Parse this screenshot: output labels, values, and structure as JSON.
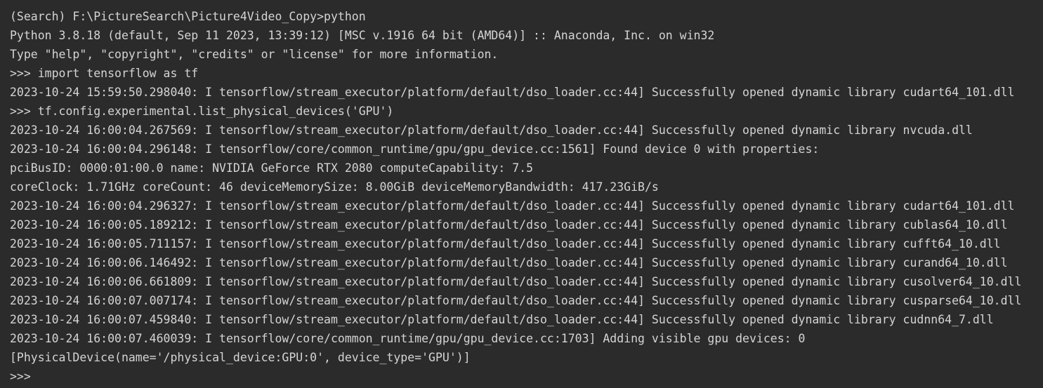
{
  "terminal": {
    "lines": [
      "(Search) F:\\PictureSearch\\Picture4Video_Copy>python",
      "Python 3.8.18 (default, Sep 11 2023, 13:39:12) [MSC v.1916 64 bit (AMD64)] :: Anaconda, Inc. on win32",
      "Type \"help\", \"copyright\", \"credits\" or \"license\" for more information.",
      ">>> import tensorflow as tf",
      "2023-10-24 15:59:50.298040: I tensorflow/stream_executor/platform/default/dso_loader.cc:44] Successfully opened dynamic library cudart64_101.dll",
      ">>> tf.config.experimental.list_physical_devices('GPU')",
      "2023-10-24 16:00:04.267569: I tensorflow/stream_executor/platform/default/dso_loader.cc:44] Successfully opened dynamic library nvcuda.dll",
      "2023-10-24 16:00:04.296148: I tensorflow/core/common_runtime/gpu/gpu_device.cc:1561] Found device 0 with properties:",
      "pciBusID: 0000:01:00.0 name: NVIDIA GeForce RTX 2080 computeCapability: 7.5",
      "coreClock: 1.71GHz coreCount: 46 deviceMemorySize: 8.00GiB deviceMemoryBandwidth: 417.23GiB/s",
      "2023-10-24 16:00:04.296327: I tensorflow/stream_executor/platform/default/dso_loader.cc:44] Successfully opened dynamic library cudart64_101.dll",
      "2023-10-24 16:00:05.189212: I tensorflow/stream_executor/platform/default/dso_loader.cc:44] Successfully opened dynamic library cublas64_10.dll",
      "2023-10-24 16:00:05.711157: I tensorflow/stream_executor/platform/default/dso_loader.cc:44] Successfully opened dynamic library cufft64_10.dll",
      "2023-10-24 16:00:06.146492: I tensorflow/stream_executor/platform/default/dso_loader.cc:44] Successfully opened dynamic library curand64_10.dll",
      "2023-10-24 16:00:06.661809: I tensorflow/stream_executor/platform/default/dso_loader.cc:44] Successfully opened dynamic library cusolver64_10.dll",
      "2023-10-24 16:00:07.007174: I tensorflow/stream_executor/platform/default/dso_loader.cc:44] Successfully opened dynamic library cusparse64_10.dll",
      "2023-10-24 16:00:07.459840: I tensorflow/stream_executor/platform/default/dso_loader.cc:44] Successfully opened dynamic library cudnn64_7.dll",
      "2023-10-24 16:00:07.460039: I tensorflow/core/common_runtime/gpu/gpu_device.cc:1703] Adding visible gpu devices: 0",
      "[PhysicalDevice(name='/physical_device:GPU:0', device_type='GPU')]"
    ],
    "prompt": ">>>"
  },
  "colors": {
    "background": "#2b2b2b",
    "text": "#d4d4d4"
  }
}
